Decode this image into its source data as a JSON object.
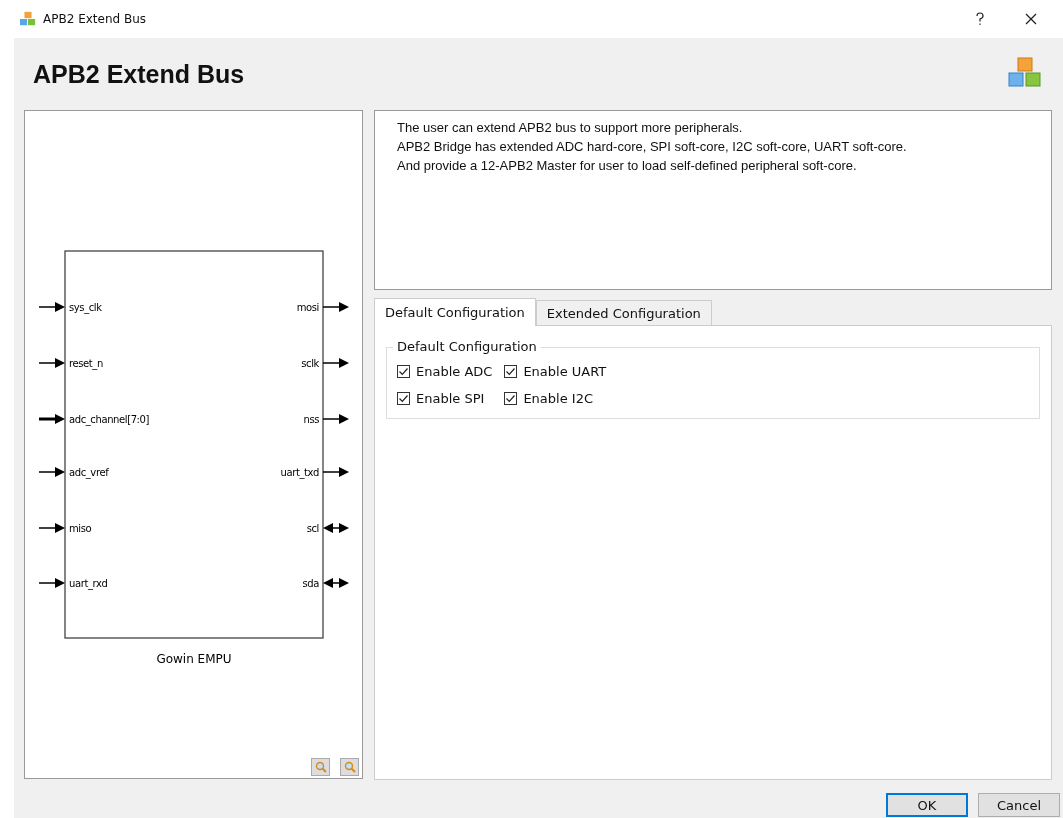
{
  "window": {
    "title": "APB2 Extend Bus"
  },
  "header": {
    "title": "APB2 Extend Bus"
  },
  "diagram": {
    "block_label": "Gowin EMPU",
    "left_ports": [
      {
        "name": "sys_clk",
        "kind": "in"
      },
      {
        "name": "reset_n",
        "kind": "in"
      },
      {
        "name": "adc_channel[7:0]",
        "kind": "bus_in"
      },
      {
        "name": "adc_vref",
        "kind": "in"
      },
      {
        "name": "miso",
        "kind": "in"
      },
      {
        "name": "uart_rxd",
        "kind": "in"
      }
    ],
    "right_ports": [
      {
        "name": "mosi",
        "kind": "out"
      },
      {
        "name": "sclk",
        "kind": "out"
      },
      {
        "name": "nss",
        "kind": "out"
      },
      {
        "name": "uart_txd",
        "kind": "out"
      },
      {
        "name": "scl",
        "kind": "inout"
      },
      {
        "name": "sda",
        "kind": "inout"
      }
    ]
  },
  "description": [
    "The user can extend APB2 bus to support more peripherals.",
    "APB2 Bridge has extended ADC hard-core, SPI soft-core, I2C soft-core, UART soft-core.",
    "And provide a 12-APB2 Master for user to load self-defined peripheral soft-core."
  ],
  "tabs": [
    {
      "label": "Default Configuration",
      "selected": true
    },
    {
      "label": "Extended Configuration",
      "selected": false
    }
  ],
  "group": {
    "title": "Default Configuration",
    "options": [
      {
        "label": "Enable ADC",
        "checked": true
      },
      {
        "label": "Enable UART",
        "checked": true
      },
      {
        "label": "Enable SPI",
        "checked": true
      },
      {
        "label": "Enable I2C",
        "checked": true
      }
    ]
  },
  "buttons": [
    {
      "label": "OK",
      "default": true
    },
    {
      "label": "Cancel",
      "default": false
    }
  ]
}
